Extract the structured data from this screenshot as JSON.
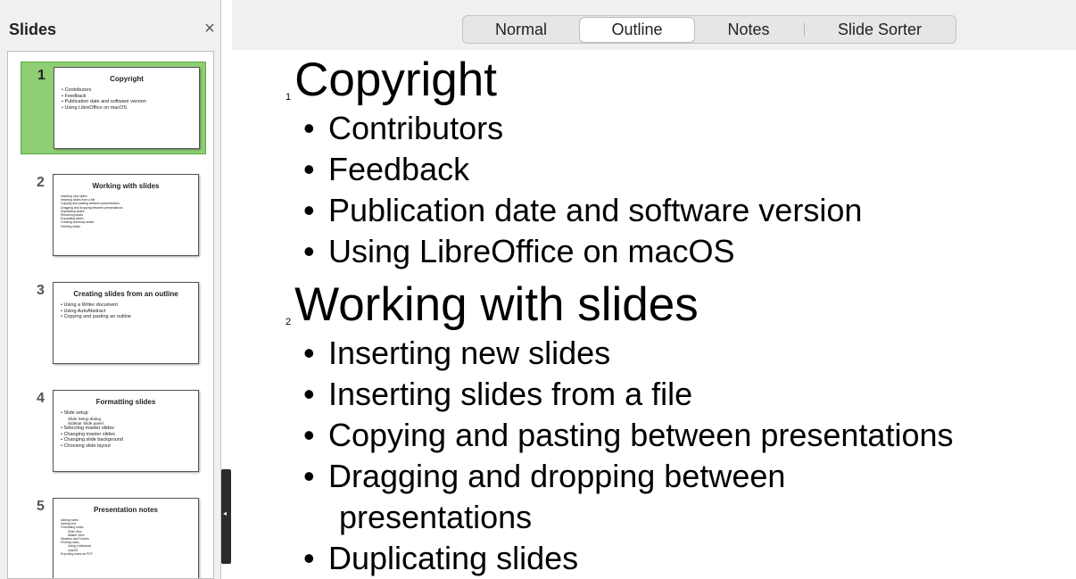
{
  "slides_pane": {
    "title": "Slides",
    "close_glyph": "×",
    "collapse_glyph": "◂",
    "thumbnails": [
      {
        "number": "1",
        "title": "Copyright",
        "bullets": [
          "• Contributors",
          "• Feedback",
          "• Publication date and software version",
          "• Using LibreOffice on macOS"
        ]
      },
      {
        "number": "2",
        "title": "Working with slides",
        "bullets": [
          "Inserting new slides",
          "Inserting slides from a file",
          "Copying and pasting between presentations",
          "Dragging and dropping between presentations",
          "Duplicating slides",
          "Renaming slides",
          "Expanding slides",
          "Creating summary slides",
          "Deleting slides"
        ]
      },
      {
        "number": "3",
        "title": "Creating slides from an outline",
        "bullets": [
          "• Using a Writer document",
          "• Using AutoAbstract",
          "• Copying and pasting an outline"
        ]
      },
      {
        "number": "4",
        "title": "Formatting slides",
        "bullets": [
          "• Slide setup",
          "Slide Setup dialog",
          "Sidebar Slide panel",
          "• Selecting master slides",
          "• Changing master slides",
          "• Changing slide background",
          "• Choosing slide layout"
        ]
      },
      {
        "number": "5",
        "title": "Presentation notes",
        "bullets": [
          "Adding notes",
          "Adding text",
          "Formatting notes",
          "Slide View",
          "Master View",
          "Headers and Footers",
          "Printing notes",
          "Using a Windows",
          "macOS",
          "Exporting notes as PDF"
        ]
      }
    ]
  },
  "view_tabs": {
    "normal": "Normal",
    "outline": "Outline",
    "notes": "Notes",
    "slide_sorter": "Slide Sorter",
    "active": "Outline"
  },
  "outline": {
    "slides": [
      {
        "number": "1",
        "title": "Copyright",
        "bullets": [
          "Contributors",
          "Feedback",
          "Publication date and software version",
          "Using LibreOffice on macOS"
        ]
      },
      {
        "number": "2",
        "title": "Working with slides",
        "bullets": [
          "Inserting new slides",
          "Inserting slides from a file",
          "Copying and pasting between presentations",
          "Dragging and dropping between",
          "presentations",
          "Duplicating slides"
        ]
      }
    ],
    "bullet_glyph": "•"
  },
  "colors": {
    "selected_thumb": "#8fce75",
    "pane_bg": "#f0f0f0"
  }
}
